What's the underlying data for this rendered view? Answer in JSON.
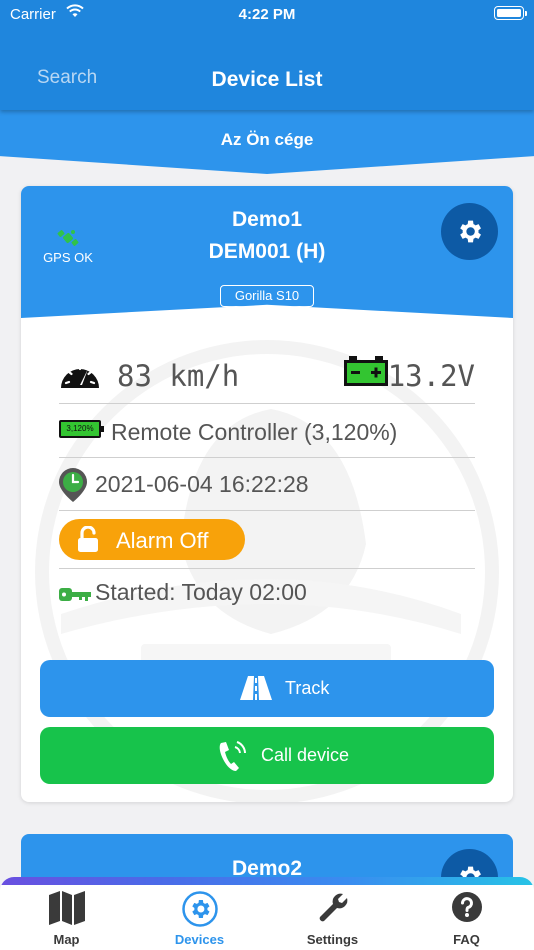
{
  "status_bar": {
    "carrier": "Carrier",
    "time": "4:22 PM"
  },
  "nav": {
    "search_label": "Search",
    "title": "Device List"
  },
  "company": {
    "name": "Az Ön cége"
  },
  "devices": [
    {
      "name": "Demo1",
      "identifier": "DEM001 (H)",
      "model": "Gorilla S10",
      "gps_status": "GPS OK",
      "speed": "83 km/h",
      "voltage": "13.2V",
      "battery_badge": "3,120%",
      "power_source": "Remote Controller (3,120%)",
      "last_update": "2021-06-04 16:22:28",
      "alarm": "Alarm Off",
      "engine": "Started: Today 02:00",
      "actions": {
        "track": "Track",
        "call": "Call device"
      }
    },
    {
      "name": "Demo2"
    }
  ],
  "tabbar": {
    "active": "Devices",
    "tabs": [
      {
        "label": "Map",
        "icon": "map-icon"
      },
      {
        "label": "Devices",
        "icon": "gear-icon"
      },
      {
        "label": "Settings",
        "icon": "wrench-icon"
      },
      {
        "label": "FAQ",
        "icon": "question-icon"
      }
    ]
  },
  "colors": {
    "primary": "#2d94ec",
    "nav": "#1f86dd",
    "gear_button": "#0d5aa5",
    "alarm": "#f8a20a",
    "call": "#17c34b"
  }
}
